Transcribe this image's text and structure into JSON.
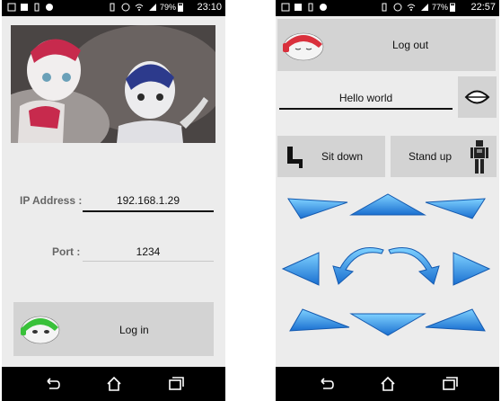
{
  "phone1": {
    "status": {
      "time": "23:10",
      "battery": "79%"
    },
    "ip_label": "IP Address :",
    "ip_value": "192.168.1.29",
    "port_label": "Port :",
    "port_value": "1234",
    "login_label": "Log in"
  },
  "phone2": {
    "status": {
      "time": "22:57",
      "battery": "77%"
    },
    "logout_label": "Log out",
    "say_value": "Hello world",
    "sit_label": "Sit down",
    "stand_label": "Stand up"
  },
  "colors": {
    "accent_blue": "#2a8fe0",
    "robot_red": "#d9303c",
    "robot_green": "#39c13a"
  },
  "icons": [
    "sitting-figure-icon",
    "standing-robot-icon",
    "speech-mouth-icon",
    "nao-head-icon",
    "back-icon",
    "home-icon",
    "recent-apps-icon",
    "wifi-icon",
    "signal-icon",
    "battery-icon",
    "alarm-icon"
  ]
}
